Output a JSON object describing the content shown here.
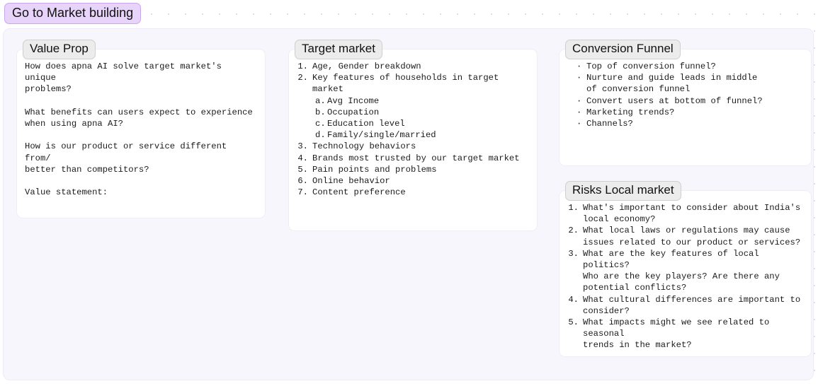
{
  "board": {
    "title": "Go to Market building",
    "title_bg": "#e8d4fa",
    "title_border": "#c9a6ee",
    "canvas_bg": "#f8f6fd"
  },
  "cards": {
    "value_prop": {
      "title": "Value Prop",
      "paragraphs": [
        "How does apna AI solve target market's unique\nproblems?",
        "What benefits can users expect to experience\nwhen using apna AI?",
        "How is our product or service different from/\nbetter than competitors?",
        "Value statement:"
      ]
    },
    "target_market": {
      "title": "Target market",
      "items": [
        {
          "marker": "1.",
          "text": "Age, Gender breakdown",
          "sub": []
        },
        {
          "marker": "2.",
          "text": "Key features of households in target market",
          "sub": [
            {
              "marker": "a.",
              "text": "Avg Income"
            },
            {
              "marker": "b.",
              "text": "Occupation"
            },
            {
              "marker": "c.",
              "text": "Education level"
            },
            {
              "marker": "d.",
              "text": "Family/single/married"
            }
          ]
        },
        {
          "marker": "3.",
          "text": "Technology behaviors",
          "sub": []
        },
        {
          "marker": "4.",
          "text": "Brands most trusted by our target market",
          "sub": []
        },
        {
          "marker": "5.",
          "text": "Pain points and problems",
          "sub": []
        },
        {
          "marker": "6.",
          "text": "Online behavior",
          "sub": []
        },
        {
          "marker": "7.",
          "text": "Content preference",
          "sub": []
        }
      ]
    },
    "conversion_funnel": {
      "title": "Conversion Funnel",
      "bullet_glyph": "·",
      "items": [
        "Top of conversion funnel?",
        "Nurture and guide leads in middle\nof conversion funnel",
        "Convert users at bottom of funnel?",
        "Marketing trends?",
        "Channels?"
      ]
    },
    "risks_local_market": {
      "title": "Risks Local market",
      "items": [
        {
          "marker": "1.",
          "text": "What's important to consider about India's\nlocal economy?"
        },
        {
          "marker": "2.",
          "text": "What local laws or regulations may cause\nissues related to our product or services?"
        },
        {
          "marker": "3.",
          "text": "What are the key features of local politics?\nWho are the key players? Are there any\npotential conflicts?"
        },
        {
          "marker": "4.",
          "text": "What cultural differences are important to\nconsider?"
        },
        {
          "marker": "5.",
          "text": "What impacts might we see related to seasonal\ntrends in the market?"
        }
      ]
    }
  }
}
